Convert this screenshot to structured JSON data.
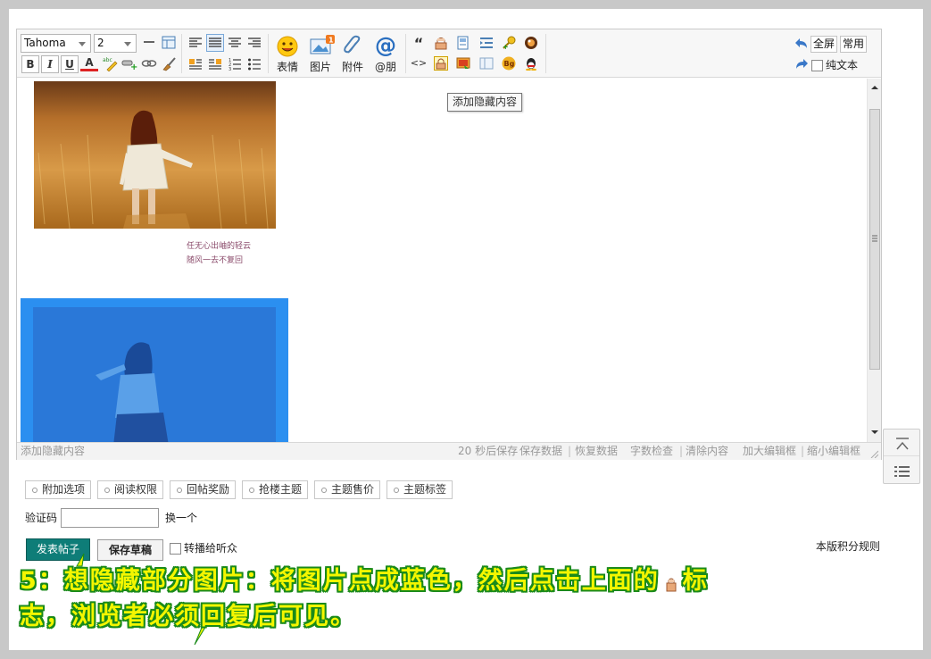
{
  "toolbar": {
    "font_name": "Tahoma",
    "font_size": "2",
    "bold": "B",
    "italic": "I",
    "underline": "U",
    "font_color": "A",
    "emoji_label": "表情",
    "image_label": "图片",
    "attach_label": "附件",
    "mention_label": "@朋",
    "quote_glyph": "“",
    "code_glyph": "<>",
    "bg_glyph": "Bg",
    "fullscreen_label": "全屏",
    "common_label": "常用",
    "plaintext_label": "纯文本",
    "image_badge": "1"
  },
  "tooltip": "添加隐藏内容",
  "content": {
    "poem_line1": "任无心出岫的轻云",
    "poem_line2": "随风一去不复回"
  },
  "statusbar": {
    "left": "添加隐藏内容",
    "autosave": "20 秒后保存",
    "save_data": "保存数据",
    "restore_data": "恢复数据",
    "word_check": "字数检查",
    "clear": "清除内容",
    "enlarge": "加大编辑框",
    "shrink": "缩小编辑框"
  },
  "options": [
    "附加选项",
    "阅读权限",
    "回帖奖励",
    "抢楼主题",
    "主题售价",
    "主题标签"
  ],
  "captcha": {
    "label": "验证码",
    "value": "",
    "change": "换一个"
  },
  "actions": {
    "post": "发表帖子",
    "draft": "保存草稿",
    "broadcast": "转播给听众",
    "rules": "本版积分规则"
  },
  "annotation": {
    "line1_a": "5：想隐藏部分图片：将图片点成蓝色，然后点击上面的",
    "line1_b": "标",
    "line2": "志，浏览者必须回复后可见。"
  },
  "colors": {
    "selection_blue": "#2b8ff0",
    "post_button": "#0e7d78",
    "annotation_text": "#f4f600",
    "annotation_outline": "#1a8a1a"
  }
}
